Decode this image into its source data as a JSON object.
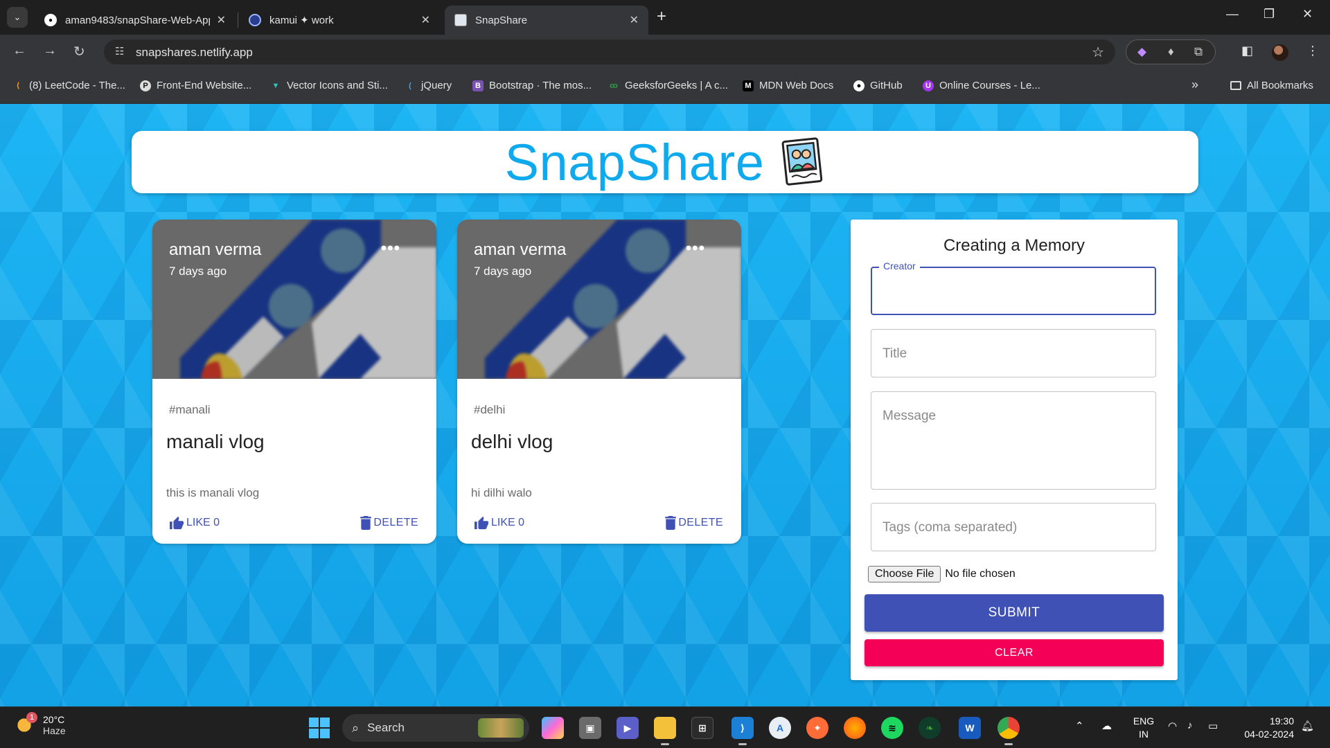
{
  "browser": {
    "tabs": [
      {
        "title": "aman9483/snapShare-Web-App",
        "close": "✕"
      },
      {
        "title": "kamui ✦ work",
        "close": "✕"
      },
      {
        "title": "SnapShare",
        "close": "✕"
      }
    ],
    "new_tab": "+",
    "url": "snapshares.netlify.app",
    "bookmarks": [
      {
        "label": "(8) LeetCode - The...",
        "icon": "leetcode-icon",
        "color": "#ffa116"
      },
      {
        "label": "Front-End Website...",
        "icon": "frontend-icon",
        "color": "#222222"
      },
      {
        "label": "Vector Icons and Sti...",
        "icon": "vector-icon",
        "color": "#2ec4b6"
      },
      {
        "label": "jQuery",
        "icon": "jquery-icon",
        "color": "#0769ad"
      },
      {
        "label": "Bootstrap · The mos...",
        "icon": "bootstrap-icon",
        "color": "#7952b3"
      },
      {
        "label": "GeeksforGeeks | A c...",
        "icon": "gfg-icon",
        "color": "#2f8d46"
      },
      {
        "label": "MDN Web Docs",
        "icon": "mdn-icon",
        "color": "#000000"
      },
      {
        "label": "GitHub",
        "icon": "github-icon",
        "color": "#ffffff"
      },
      {
        "label": "Online Courses - Le...",
        "icon": "udemy-icon",
        "color": "#a435f0"
      }
    ],
    "all_bookmarks": "All Bookmarks",
    "overflow": "»"
  },
  "app": {
    "title": "SnapShare",
    "accent": "#0fa9ee"
  },
  "posts": [
    {
      "creator": "aman verma",
      "time": "7 days ago",
      "tags": "#manali",
      "title": "manali vlog",
      "message": "this is manali vlog",
      "like_label": "LIKE 0",
      "delete_label": "DELETE",
      "more": "•••"
    },
    {
      "creator": "aman verma",
      "time": "7 days ago",
      "tags": "#delhi",
      "title": "delhi vlog",
      "message": "hi dilhi walo",
      "like_label": "LIKE 0",
      "delete_label": "DELETE",
      "more": "•••"
    }
  ],
  "form": {
    "title": "Creating a Memory",
    "creator_label": "Creator",
    "creator_value": "",
    "title_placeholder": "Title",
    "message_placeholder": "Message",
    "tags_placeholder": "Tags (coma separated)",
    "choose_file": "Choose File",
    "no_file": "No file chosen",
    "submit": "SUBMIT",
    "clear": "CLEAR",
    "primary_color": "#3f51b5",
    "secondary_color": "#f50057"
  },
  "taskbar": {
    "weather_temp": "20°C",
    "weather_desc": "Haze",
    "weather_badge": "1",
    "search": "Search",
    "lang_1": "ENG",
    "lang_2": "IN",
    "time": "19:30",
    "date": "04-02-2024"
  }
}
